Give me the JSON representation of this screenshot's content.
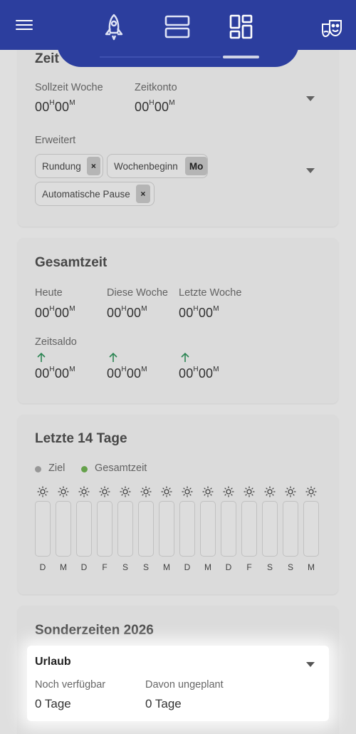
{
  "appbar": {
    "nav_icons": [
      "rocket-icon",
      "rows-icon",
      "dashboard-icon"
    ],
    "active_tab": 2,
    "right_icon": "theater-masks-icon"
  },
  "zeit_card": {
    "title_partial": "Zeit",
    "sollzeit_label": "Sollzeit Woche",
    "sollzeit_h": "00",
    "sollzeit_m": "00",
    "zeitkonto_label": "Zeitkonto",
    "zeitkonto_h": "00",
    "zeitkonto_m": "00",
    "erweitert_label": "Erweitert",
    "chips": {
      "rundung": "Rundung",
      "rundung_x": "×",
      "wochenbeginn": "Wochenbeginn",
      "wochenbeginn_value": "Mo",
      "pause": "Automatische Pause",
      "pause_x": "×"
    }
  },
  "gesamt_card": {
    "title": "Gesamtzeit",
    "heute_label": "Heute",
    "diese_label": "Diese Woche",
    "letzte_label": "Letzte Woche",
    "saldo_label": "Zeitsaldo",
    "h_unit": "H",
    "m_unit": "M",
    "values": [
      "00",
      "00",
      "00",
      "00",
      "00",
      "00"
    ],
    "saldo_values": [
      "00",
      "00",
      "00",
      "00",
      "00",
      "00"
    ]
  },
  "letzte_card": {
    "title": "Letzte 14 Tage",
    "legend_ziel": "Ziel",
    "legend_gesamt": "Gesamtzeit",
    "legend_ziel_color": "#9e9e9e",
    "legend_gesamt_color": "#6aa84f",
    "days": [
      "D",
      "M",
      "D",
      "F",
      "S",
      "S",
      "M",
      "D",
      "M",
      "D",
      "F",
      "S",
      "S",
      "M"
    ]
  },
  "sonder_card": {
    "title": "Sonderzeiten 2026",
    "urlaub_label": "Urlaub",
    "noch_label": "Noch verfügbar",
    "noch_value": "0 Tage",
    "ungeplant_label": "Davon ungeplant",
    "ungeplant_value": "0 Tage"
  },
  "colors": {
    "appbar": "#2c3e9e",
    "up_arrow": "#2e8b57"
  }
}
